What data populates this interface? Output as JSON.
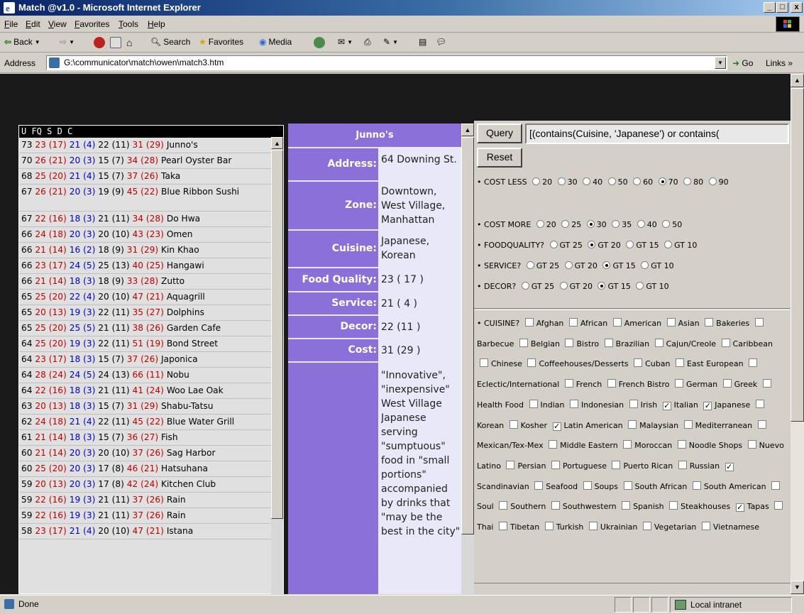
{
  "window": {
    "title": "Match @v1.0 - Microsoft Internet Explorer"
  },
  "menu": [
    "File",
    "Edit",
    "View",
    "Favorites",
    "Tools",
    "Help"
  ],
  "toolbar": {
    "back": "Back",
    "search": "Search",
    "favorites": "Favorites",
    "media": "Media"
  },
  "address": {
    "label": "Address",
    "url": "G:\\communicator\\match\\owen\\match3.htm",
    "go": "Go",
    "links": "Links »"
  },
  "list": {
    "header": "U FQ S D C",
    "rows": [
      {
        "u": "73",
        "fq": "23",
        "fqp": "(17)",
        "s": "21",
        "sp": "(4)",
        "d": "22",
        "dp": "(11)",
        "c": "31",
        "cp": "(29)",
        "name": "Junno's"
      },
      {
        "u": "70",
        "fq": "26",
        "fqp": "(21)",
        "s": "20",
        "sp": "(3)",
        "d": "15",
        "dp": "(7)",
        "c": "34",
        "cp": "(28)",
        "name": "Pearl Oyster Bar"
      },
      {
        "u": "68",
        "fq": "25",
        "fqp": "(20)",
        "s": "21",
        "sp": "(4)",
        "d": "15",
        "dp": "(7)",
        "c": "37",
        "cp": "(26)",
        "name": "Taka"
      },
      {
        "u": "67",
        "fq": "26",
        "fqp": "(21)",
        "s": "20",
        "sp": "(3)",
        "d": "19",
        "dp": "(9)",
        "c": "45",
        "cp": "(22)",
        "name": "Blue Ribbon Sushi"
      },
      {
        "u": "67",
        "fq": "22",
        "fqp": "(16)",
        "s": "18",
        "sp": "(3)",
        "d": "21",
        "dp": "(11)",
        "c": "34",
        "cp": "(28)",
        "name": "Do Hwa"
      },
      {
        "u": "66",
        "fq": "24",
        "fqp": "(18)",
        "s": "20",
        "sp": "(3)",
        "d": "20",
        "dp": "(10)",
        "c": "43",
        "cp": "(23)",
        "name": "Omen"
      },
      {
        "u": "66",
        "fq": "21",
        "fqp": "(14)",
        "s": "16",
        "sp": "(2)",
        "d": "18",
        "dp": "(9)",
        "c": "31",
        "cp": "(29)",
        "name": "Kin Khao"
      },
      {
        "u": "66",
        "fq": "23",
        "fqp": "(17)",
        "s": "24",
        "sp": "(5)",
        "d": "25",
        "dp": "(13)",
        "c": "40",
        "cp": "(25)",
        "name": "Hangawi"
      },
      {
        "u": "66",
        "fq": "21",
        "fqp": "(14)",
        "s": "18",
        "sp": "(3)",
        "d": "18",
        "dp": "(9)",
        "c": "33",
        "cp": "(28)",
        "name": "Zutto"
      },
      {
        "u": "65",
        "fq": "25",
        "fqp": "(20)",
        "s": "22",
        "sp": "(4)",
        "d": "20",
        "dp": "(10)",
        "c": "47",
        "cp": "(21)",
        "name": "Aquagrill"
      },
      {
        "u": "65",
        "fq": "20",
        "fqp": "(13)",
        "s": "19",
        "sp": "(3)",
        "d": "22",
        "dp": "(11)",
        "c": "35",
        "cp": "(27)",
        "name": "Dolphins"
      },
      {
        "u": "65",
        "fq": "25",
        "fqp": "(20)",
        "s": "25",
        "sp": "(5)",
        "d": "21",
        "dp": "(11)",
        "c": "38",
        "cp": "(26)",
        "name": "Garden Cafe"
      },
      {
        "u": "64",
        "fq": "25",
        "fqp": "(20)",
        "s": "19",
        "sp": "(3)",
        "d": "22",
        "dp": "(11)",
        "c": "51",
        "cp": "(19)",
        "name": "Bond Street"
      },
      {
        "u": "64",
        "fq": "23",
        "fqp": "(17)",
        "s": "18",
        "sp": "(3)",
        "d": "15",
        "dp": "(7)",
        "c": "37",
        "cp": "(26)",
        "name": "Japonica"
      },
      {
        "u": "64",
        "fq": "28",
        "fqp": "(24)",
        "s": "24",
        "sp": "(5)",
        "d": "24",
        "dp": "(13)",
        "c": "66",
        "cp": "(11)",
        "name": "Nobu"
      },
      {
        "u": "64",
        "fq": "22",
        "fqp": "(16)",
        "s": "18",
        "sp": "(3)",
        "d": "21",
        "dp": "(11)",
        "c": "41",
        "cp": "(24)",
        "name": "Woo Lae Oak"
      },
      {
        "u": "63",
        "fq": "20",
        "fqp": "(13)",
        "s": "18",
        "sp": "(3)",
        "d": "15",
        "dp": "(7)",
        "c": "31",
        "cp": "(29)",
        "name": "Shabu-Tatsu"
      },
      {
        "u": "62",
        "fq": "24",
        "fqp": "(18)",
        "s": "21",
        "sp": "(4)",
        "d": "22",
        "dp": "(11)",
        "c": "45",
        "cp": "(22)",
        "name": "Blue Water Grill"
      },
      {
        "u": "61",
        "fq": "21",
        "fqp": "(14)",
        "s": "18",
        "sp": "(3)",
        "d": "15",
        "dp": "(7)",
        "c": "36",
        "cp": "(27)",
        "name": "Fish"
      },
      {
        "u": "60",
        "fq": "21",
        "fqp": "(14)",
        "s": "20",
        "sp": "(3)",
        "d": "20",
        "dp": "(10)",
        "c": "37",
        "cp": "(26)",
        "name": "Sag Harbor"
      },
      {
        "u": "60",
        "fq": "25",
        "fqp": "(20)",
        "s": "20",
        "sp": "(3)",
        "d": "17",
        "dp": "(8)",
        "c": "46",
        "cp": "(21)",
        "name": "Hatsuhana"
      },
      {
        "u": "59",
        "fq": "20",
        "fqp": "(13)",
        "s": "20",
        "sp": "(3)",
        "d": "17",
        "dp": "(8)",
        "c": "42",
        "cp": "(24)",
        "name": "Kitchen Club"
      },
      {
        "u": "59",
        "fq": "22",
        "fqp": "(16)",
        "s": "19",
        "sp": "(3)",
        "d": "21",
        "dp": "(11)",
        "c": "37",
        "cp": "(26)",
        "name": "Rain"
      },
      {
        "u": "59",
        "fq": "22",
        "fqp": "(16)",
        "s": "19",
        "sp": "(3)",
        "d": "21",
        "dp": "(11)",
        "c": "37",
        "cp": "(26)",
        "name": "Rain"
      },
      {
        "u": "58",
        "fq": "23",
        "fqp": "(17)",
        "s": "21",
        "sp": "(4)",
        "d": "20",
        "dp": "(10)",
        "c": "47",
        "cp": "(21)",
        "name": "Istana"
      }
    ]
  },
  "detail": {
    "name": "Junno's",
    "address_label": "Address:",
    "address": "64 Downing St.",
    "zone_label": "Zone:",
    "zone": "Downtown, West Village, Manhattan",
    "cuisine_label": "Cuisine:",
    "cuisine": "Japanese, Korean",
    "food_label": "Food Quality:",
    "food": "23 ( 17 )",
    "service_label": "Service:",
    "service": "21 ( 4 )",
    "decor_label": "Decor:",
    "decor": "22 (11 )",
    "cost_label": "Cost:",
    "cost": "31 (29 )",
    "review": "\"Innovative\", \"inexpensive\" West Village Japanese serving \"sumptuous\" food in \"small portions\" accompanied by drinks that \"may be the best in the city\""
  },
  "query": {
    "query_label": "Query",
    "reset_label": "Reset",
    "expression": "[(contains(Cuisine, 'Japanese') or contains(",
    "cost_less": {
      "label": "COST LESS",
      "options": [
        "20",
        "30",
        "40",
        "50",
        "60",
        "70",
        "80",
        "90"
      ],
      "selected": "70"
    },
    "cost_more": {
      "label": "COST MORE",
      "options": [
        "20",
        "25",
        "30",
        "35",
        "40",
        "50"
      ],
      "selected": "30"
    },
    "food_quality": {
      "label": "FOODQUALITY?",
      "options": [
        "GT 25",
        "GT 20",
        "GT 15",
        "GT 10"
      ],
      "selected": "GT 20"
    },
    "service": {
      "label": "SERVICE?",
      "options": [
        "GT 25",
        "GT 20",
        "GT 15",
        "GT 10"
      ],
      "selected": "GT 15"
    },
    "decor": {
      "label": "DECOR?",
      "options": [
        "GT 25",
        "GT 20",
        "GT 15",
        "GT 10"
      ],
      "selected": "GT 15"
    },
    "cuisine_label": "CUISINE?",
    "cuisines": [
      {
        "name": "Afghan",
        "checked": false
      },
      {
        "name": "African",
        "checked": false
      },
      {
        "name": "American",
        "checked": false
      },
      {
        "name": "Asian",
        "checked": false
      },
      {
        "name": "Bakeries",
        "checked": false
      },
      {
        "name": "Barbecue",
        "checked": false
      },
      {
        "name": "Belgian",
        "checked": false
      },
      {
        "name": "Bistro",
        "checked": false
      },
      {
        "name": "Brazilian",
        "checked": false
      },
      {
        "name": "Cajun/Creole",
        "checked": false
      },
      {
        "name": "Caribbean",
        "checked": false
      },
      {
        "name": "Chinese",
        "checked": false
      },
      {
        "name": "Coffeehouses/Desserts",
        "checked": false
      },
      {
        "name": "Cuban",
        "checked": false
      },
      {
        "name": "East European",
        "checked": false
      },
      {
        "name": "Eclectic/International",
        "checked": false
      },
      {
        "name": "French",
        "checked": false
      },
      {
        "name": "French Bistro",
        "checked": false
      },
      {
        "name": "German",
        "checked": false
      },
      {
        "name": "Greek",
        "checked": false
      },
      {
        "name": "Health Food",
        "checked": false
      },
      {
        "name": "Indian",
        "checked": false
      },
      {
        "name": "Indonesian",
        "checked": false
      },
      {
        "name": "Irish",
        "checked": false
      },
      {
        "name": "Italian",
        "checked": true
      },
      {
        "name": "Japanese",
        "checked": true
      },
      {
        "name": "Korean",
        "checked": false
      },
      {
        "name": "Kosher",
        "checked": false
      },
      {
        "name": "Latin American",
        "checked": true
      },
      {
        "name": "Malaysian",
        "checked": false
      },
      {
        "name": "Mediterranean",
        "checked": false
      },
      {
        "name": "Mexican/Tex-Mex",
        "checked": false
      },
      {
        "name": "Middle Eastern",
        "checked": false
      },
      {
        "name": "Moroccan",
        "checked": false
      },
      {
        "name": "Noodle Shops",
        "checked": false
      },
      {
        "name": "Nuevo Latino",
        "checked": false
      },
      {
        "name": "Persian",
        "checked": false
      },
      {
        "name": "Portuguese",
        "checked": false
      },
      {
        "name": "Puerto Rican",
        "checked": false
      },
      {
        "name": "Russian",
        "checked": false
      },
      {
        "name": "Scandinavian",
        "checked": true
      },
      {
        "name": "Seafood",
        "checked": false
      },
      {
        "name": "Soups",
        "checked": false
      },
      {
        "name": "South African",
        "checked": false
      },
      {
        "name": "South American",
        "checked": false
      },
      {
        "name": "Soul",
        "checked": false
      },
      {
        "name": "Southern",
        "checked": false
      },
      {
        "name": "Southwestern",
        "checked": false
      },
      {
        "name": "Spanish",
        "checked": false
      },
      {
        "name": "Steakhouses",
        "checked": false
      },
      {
        "name": "Tapas",
        "checked": true
      },
      {
        "name": "Thai",
        "checked": false
      },
      {
        "name": "Tibetan",
        "checked": false
      },
      {
        "name": "Turkish",
        "checked": false
      },
      {
        "name": "Ukrainian",
        "checked": false
      },
      {
        "name": "Vegetarian",
        "checked": false
      },
      {
        "name": "Vietnamese",
        "checked": false
      }
    ]
  },
  "status": {
    "text": "Done",
    "zone": "Local intranet"
  },
  "colors": {
    "accent": "#8a70d8",
    "rating_red": "#c00000",
    "rating_blue": "#0000c0",
    "titlebar": "#0a246a"
  }
}
